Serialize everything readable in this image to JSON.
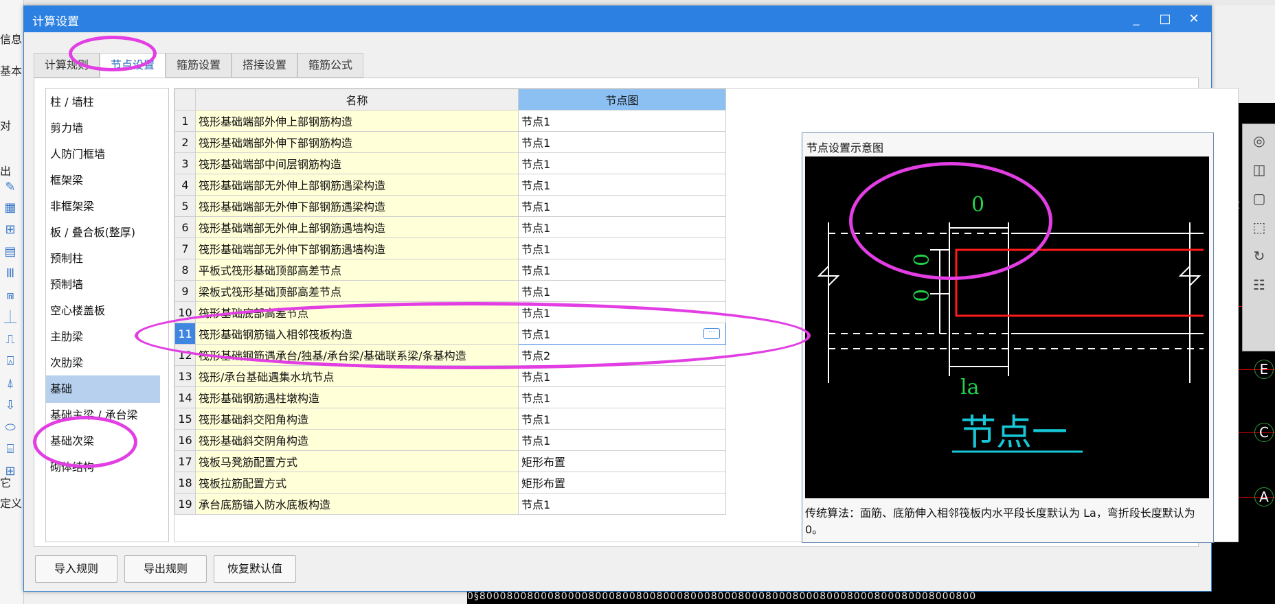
{
  "background": {
    "left_labels": [
      "信息",
      "基本",
      "对",
      "出",
      "它",
      "定义"
    ],
    "cad_axis": [
      "G",
      "E",
      "C",
      "A"
    ],
    "cad_numbers": [
      "2",
      "00"
    ],
    "bottom_numbers": "0§8000800800080000800080080080008000800080008000800080008000800080008000800"
  },
  "dialog": {
    "title": "计算设置",
    "minimize": "_",
    "maximize": "□",
    "close": "✕",
    "tabs": [
      "计算规则",
      "节点设置",
      "箍筋设置",
      "搭接设置",
      "箍筋公式"
    ],
    "active_tab": 1,
    "categories": [
      "柱 / 墙柱",
      "剪力墙",
      "人防门框墙",
      "框架梁",
      "非框架梁",
      "板 / 叠合板(整厚)",
      "预制柱",
      "预制墙",
      "空心楼盖板",
      "主肋梁",
      "次肋梁",
      "基础",
      "基础主梁 / 承台梁",
      "基础次梁",
      "砌体结构"
    ],
    "selected_category": 11,
    "table": {
      "headers": [
        "",
        "名称",
        "节点图"
      ],
      "rows": [
        {
          "no": "1",
          "name": "筏形基础端部外伸上部钢筋构造",
          "value": "节点1"
        },
        {
          "no": "2",
          "name": "筏形基础端部外伸下部钢筋构造",
          "value": "节点1"
        },
        {
          "no": "3",
          "name": "筏形基础端部中间层钢筋构造",
          "value": "节点1"
        },
        {
          "no": "4",
          "name": "筏形基础端部无外伸上部钢筋遇梁构造",
          "value": "节点1"
        },
        {
          "no": "5",
          "name": "筏形基础端部无外伸下部钢筋遇梁构造",
          "value": "节点1"
        },
        {
          "no": "6",
          "name": "筏形基础端部无外伸上部钢筋遇墙构造",
          "value": "节点1"
        },
        {
          "no": "7",
          "name": "筏形基础端部无外伸下部钢筋遇墙构造",
          "value": "节点1"
        },
        {
          "no": "8",
          "name": "平板式筏形基础顶部高差节点",
          "value": "节点1"
        },
        {
          "no": "9",
          "name": "梁板式筏形基础顶部高差节点",
          "value": "节点1"
        },
        {
          "no": "10",
          "name": "筏形基础底部高差节点",
          "value": "节点1"
        },
        {
          "no": "11",
          "name": "筏形基础钢筋锚入相邻筏板构造",
          "value": "节点1"
        },
        {
          "no": "12",
          "name": "筏形基础钢筋遇承台/独基/承台梁/基础联系梁/条基构造",
          "value": "节点2"
        },
        {
          "no": "13",
          "name": "筏形/承台基础遇集水坑节点",
          "value": "节点1"
        },
        {
          "no": "14",
          "name": "筏形基础钢筋遇柱墩构造",
          "value": "节点1"
        },
        {
          "no": "15",
          "name": "筏形基础斜交阳角构造",
          "value": "节点1"
        },
        {
          "no": "16",
          "name": "筏形基础斜交阴角构造",
          "value": "节点1"
        },
        {
          "no": "17",
          "name": "筏板马凳筋配置方式",
          "value": "矩形布置"
        },
        {
          "no": "18",
          "name": "筏板拉筋配置方式",
          "value": "矩形布置"
        },
        {
          "no": "19",
          "name": "承台底筋锚入防水底板构造",
          "value": "节点1"
        }
      ],
      "selected_row": 10,
      "ellipsis": "···"
    },
    "preview": {
      "title": "节点设置示意图",
      "labels": {
        "top": "0",
        "left1": "0",
        "left2": "0",
        "bottom": "la",
        "caption": "节点一"
      },
      "colors": {
        "dim": "#22d04a",
        "rebar": "#ff1a1a",
        "line": "#ffffff",
        "caption": "#16c8d8"
      },
      "description": "传统算法：面筋、底筋伸入相邻筏板内水平段长度默认为 La，弯折段长度默认为 0。"
    },
    "buttons": [
      "导入规则",
      "导出规则",
      "恢复默认值"
    ]
  },
  "annotation_color": "#e23ee3"
}
